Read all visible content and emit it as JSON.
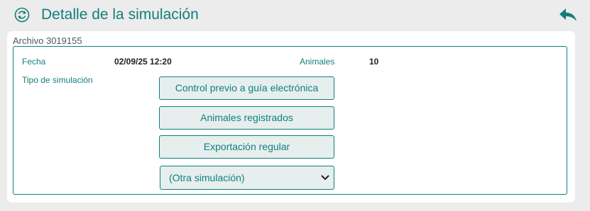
{
  "header": {
    "title": "Detalle de la simulación",
    "sync_icon": "sync-circle-icon",
    "back_icon": "reply-arrow-icon"
  },
  "file": {
    "label": "Archivo 3019155"
  },
  "details": {
    "fecha_label": "Fecha",
    "fecha_value": "02/09/25 12:20",
    "animales_label": "Animales",
    "animales_value": "10",
    "tipo_label": "Tipo de simulación"
  },
  "buttons": [
    {
      "label": "Control previo a guía electrónica"
    },
    {
      "label": "Animales registrados"
    },
    {
      "label": "Exportación regular"
    }
  ],
  "select": {
    "value": "(Otra simulación)",
    "icon": "chevron-down-icon"
  },
  "colors": {
    "accent": "#127f7c",
    "background": "#ececec",
    "button_bg": "#e6eeee"
  }
}
